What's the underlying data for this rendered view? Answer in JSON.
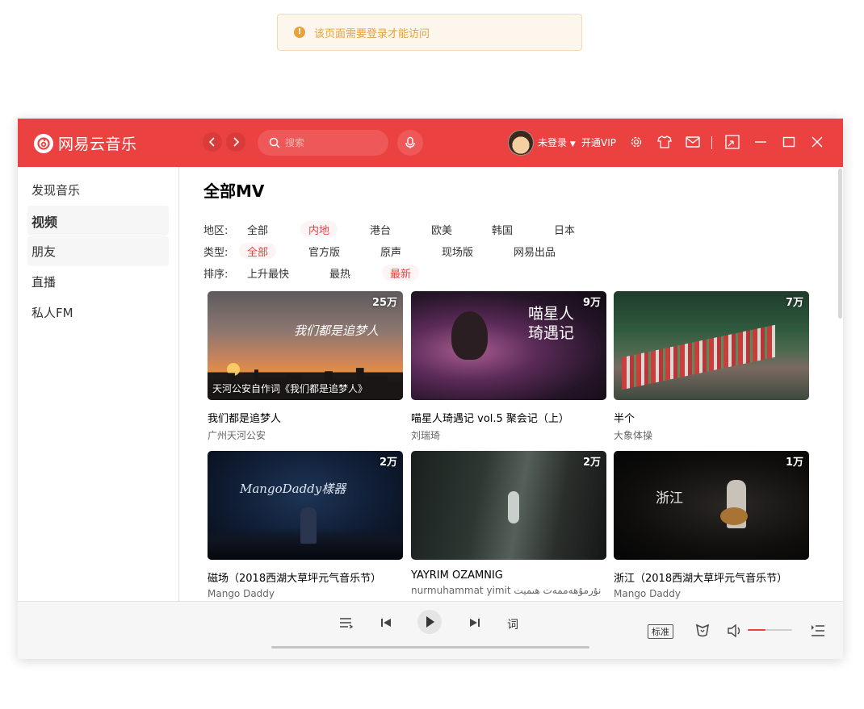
{
  "toast": {
    "icon": "warning-icon",
    "message": "该页面需要登录才能访问"
  },
  "app": {
    "name": "网易云音乐",
    "search_placeholder": "搜索",
    "user_status": "未登录",
    "vip_label": "开通VIP",
    "brand_color": "#ec4141"
  },
  "sidebar": {
    "items": [
      {
        "label": "发现音乐"
      },
      {
        "label": "视频",
        "active": true
      },
      {
        "label": "朋友"
      },
      {
        "label": "直播"
      },
      {
        "label": "私人FM"
      }
    ]
  },
  "main": {
    "title": "全部MV",
    "filters": {
      "area": {
        "label": "地区:",
        "options": [
          "全部",
          "内地",
          "港台",
          "欧美",
          "韩国",
          "日本"
        ],
        "selected": "内地"
      },
      "type": {
        "label": "类型:",
        "options": [
          "全部",
          "官方版",
          "原声",
          "现场版",
          "网易出品"
        ],
        "selected": "全部"
      },
      "order": {
        "label": "排序:",
        "options": [
          "上升最快",
          "最热",
          "最新"
        ],
        "selected": "最新"
      }
    },
    "mvs": [
      {
        "title": "我们都是追梦人",
        "artist": "广州天河公安",
        "plays": "25万",
        "overlay": "天河公安自作词《我们都是追梦人》",
        "art": "我们都是追梦人"
      },
      {
        "title": "喵星人琦遇记 vol.5 聚会记（上）",
        "artist": "刘瑞琦",
        "plays": "9万",
        "overlay": "",
        "art": "喵星人 琦遇记"
      },
      {
        "title": "半个",
        "artist": "大象体操",
        "plays": "7万",
        "overlay": "",
        "art": ""
      },
      {
        "title": "磁场（2018西湖大草坪元气音乐节）",
        "artist": "Mango Daddy",
        "plays": "2万",
        "overlay": "",
        "art": "MangoDaddy樣器"
      },
      {
        "title": "YAYRIM OZAMNIG",
        "artist": "nurmuhammat yimit نۇرمۇھەممەت ھىميت",
        "plays": "2万",
        "overlay": "",
        "art": ""
      },
      {
        "title": "浙江（2018西湖大草坪元气音乐节）",
        "artist": "Mango Daddy",
        "plays": "1万",
        "overlay": "",
        "art": "浙江"
      }
    ]
  },
  "player": {
    "lyric_label": "词",
    "quality_label": "标准",
    "volume": 0.4,
    "progress": 0
  }
}
